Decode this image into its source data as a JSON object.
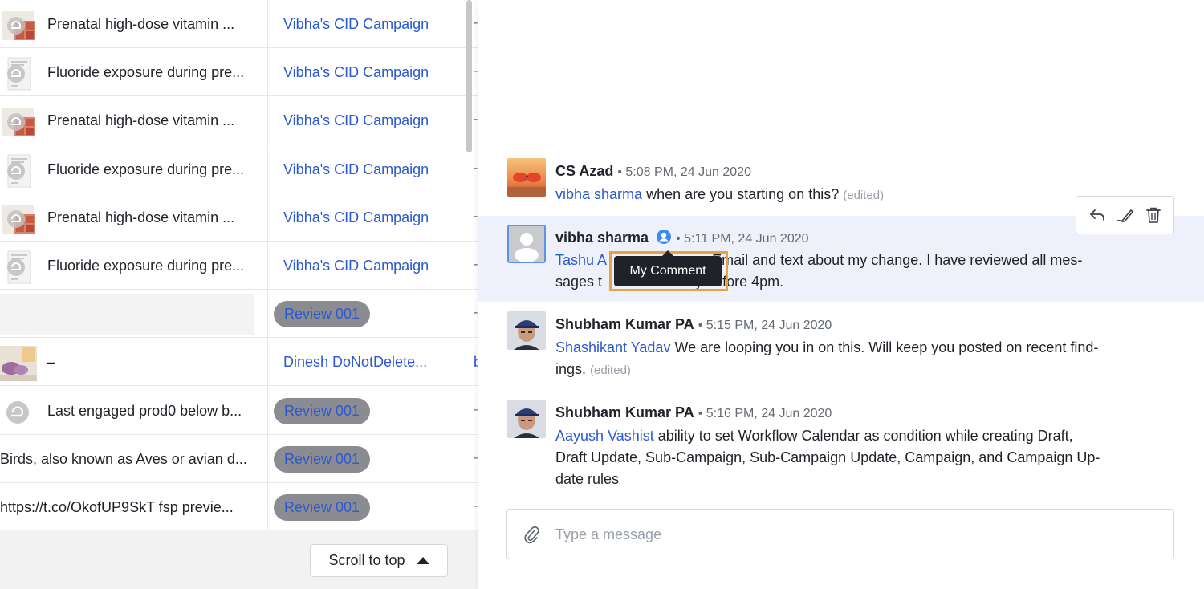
{
  "table": {
    "rows": [
      {
        "kind": "stack",
        "title": "Prenatal high-dose vitamin ...",
        "campaign": "Vibha's CID Campaign",
        "col3": "-"
      },
      {
        "kind": "doc",
        "title": "Fluoride exposure during pre...",
        "campaign": "Vibha's CID Campaign",
        "col3": "-"
      },
      {
        "kind": "stack",
        "title": "Prenatal high-dose vitamin ...",
        "campaign": "Vibha's CID Campaign",
        "col3": "-"
      },
      {
        "kind": "doc",
        "title": "Fluoride exposure during pre...",
        "campaign": "Vibha's CID Campaign",
        "col3": "-"
      },
      {
        "kind": "stack",
        "title": "Prenatal high-dose vitamin ...",
        "campaign": "Vibha's CID Campaign",
        "col3": "-"
      },
      {
        "kind": "doc",
        "title": "Fluoride exposure during pre...",
        "campaign": "Vibha's CID Campaign",
        "col3": "-"
      },
      {
        "kind": "grey",
        "title": "",
        "pill": "Review 001",
        "col3": "-"
      },
      {
        "kind": "photo",
        "title": "–",
        "campaign": "Dinesh DoNotDelete...",
        "col3": "b"
      },
      {
        "kind": "logo",
        "title": "Last engaged prod0 below b...",
        "pill": "Review 001",
        "col3": "-"
      },
      {
        "kind": "none",
        "title": "Birds, also known as Aves or avian d...",
        "pill": "Review 001",
        "col3": "-"
      },
      {
        "kind": "none",
        "title": "https://t.co/OkofUP9SkT fsp previe...",
        "pill": "Review 001",
        "col3": "-"
      }
    ]
  },
  "footer": {
    "scroll_to_top": "Scroll to top"
  },
  "comments": [
    {
      "author": "CS Azad",
      "meta": "5:08 PM, 24 Jun 2020",
      "mention": "vibha sharma",
      "text": "when are you starting on this?",
      "edited": "(edited)"
    },
    {
      "author": "vibha sharma",
      "meta": "5:11 PM, 24 Jun 2020",
      "mention": "Tashu A",
      "text_line1": "Email and text about my change. I have reviewed all mes-",
      "text_line2a": "sages t",
      "text_line2b": "y before 4pm."
    },
    {
      "author": "Shubham Kumar PA",
      "meta": "5:15 PM, 24 Jun 2020",
      "mention": "Shashikant Yadav",
      "text_line1": "We are looping you in on this. Will keep you posted on recent find-",
      "text_line2": "ings.",
      "edited": "(edited)"
    },
    {
      "author": "Shubham Kumar PA",
      "meta": "5:16 PM, 24 Jun 2020",
      "mention": "Aayush Vashist",
      "text_line1": "ability to set Workflow Calendar as condition while creating Draft,",
      "text_line2": "Draft Update, Sub-Campaign, Sub-Campaign Update, Campaign, and Campaign Up-",
      "text_line3": "date rules"
    }
  ],
  "tooltip": "My Comment",
  "composer": {
    "placeholder": "Type a message"
  },
  "colors": {
    "link": "#2a59d1",
    "highlight_row": "#eef1fb",
    "tooltip_frame": "#e8a33a"
  }
}
